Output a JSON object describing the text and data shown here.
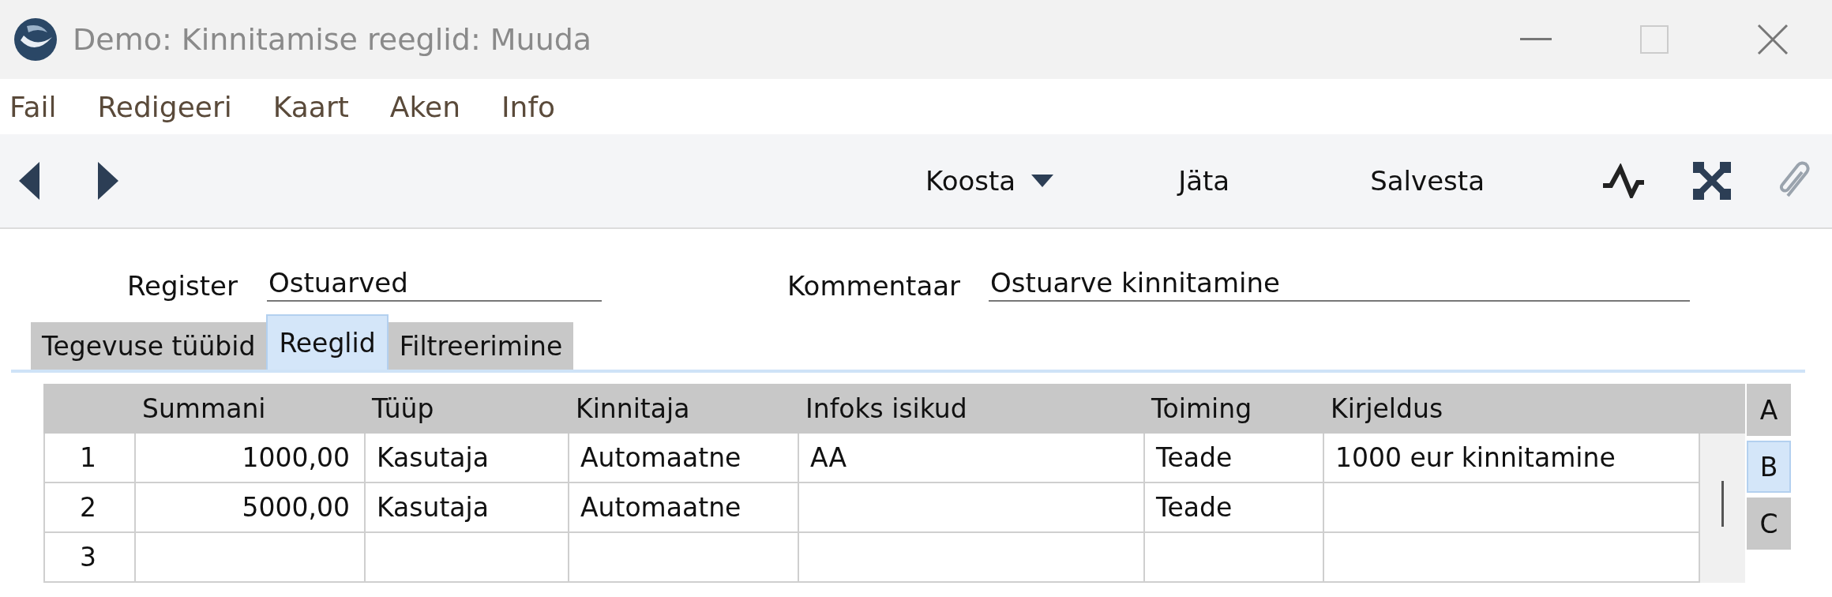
{
  "window": {
    "title": "Demo: Kinnitamise reeglid: Muuda"
  },
  "menu": [
    "Fail",
    "Redigeeri",
    "Kaart",
    "Aken",
    "Info"
  ],
  "toolbar": {
    "buttons": [
      {
        "label": "Koosta",
        "kind": "dropdown"
      },
      {
        "label": "Jäta",
        "kind": "plain"
      },
      {
        "label": "Salvesta",
        "kind": "plain"
      }
    ]
  },
  "header_fields": [
    {
      "label": "Register",
      "value": "Ostuarved"
    },
    {
      "label": "Kommentaar",
      "value": "Ostuarve kinnitamine"
    }
  ],
  "tabs": [
    {
      "label": "Tegevuse tüübid",
      "selected": false
    },
    {
      "label": "Reeglid",
      "selected": true
    },
    {
      "label": "Filtreerimine",
      "selected": false
    }
  ],
  "table": {
    "columns": [
      "",
      "Summani",
      "Tüüp",
      "Kinnitaja",
      "Infoks isikud",
      "Toiming",
      "Kirjeldus"
    ],
    "rows": [
      [
        "1",
        "1000,00",
        "Kasutaja",
        "Automaatne",
        "AA",
        "Teade",
        "1000 eur kinnitamine"
      ],
      [
        "2",
        "5000,00",
        "Kasutaja",
        "Automaatne",
        "",
        "Teade",
        ""
      ],
      [
        "3",
        "",
        "",
        "",
        "",
        "",
        ""
      ]
    ]
  },
  "side_tabs": [
    {
      "label": "A",
      "selected": false
    },
    {
      "label": "B",
      "selected": true
    },
    {
      "label": "C",
      "selected": false
    }
  ]
}
